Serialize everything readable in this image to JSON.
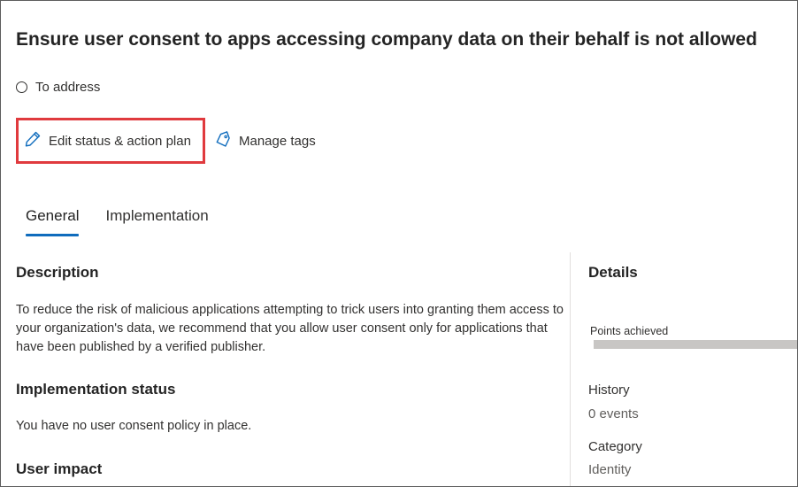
{
  "page": {
    "title": "Ensure user consent to apps accessing company data on their behalf is not allowed",
    "status_label": "To address"
  },
  "actions": {
    "edit_label": "Edit status & action plan",
    "tags_label": "Manage tags"
  },
  "tabs": [
    {
      "label": "General",
      "active": true
    },
    {
      "label": "Implementation",
      "active": false
    }
  ],
  "main": {
    "description_heading": "Description",
    "description_text": "To reduce the risk of malicious applications attempting to trick users into granting them access to your organization's data, we recommend that you allow user consent only for applications that have been published by a verified publisher.",
    "implementation_heading": "Implementation status",
    "implementation_text": "You have no user consent policy in place.",
    "user_impact_heading": "User impact"
  },
  "details": {
    "heading": "Details",
    "points_label": "Points achieved",
    "points_progress_fraction": 0,
    "history_label": "History",
    "history_value": "0 events",
    "category_label": "Category",
    "category_value": "Identity"
  },
  "colors": {
    "highlight_border": "#e03a3e",
    "accent": "#0f6cbd",
    "progress_track": "#c8c6c4"
  }
}
